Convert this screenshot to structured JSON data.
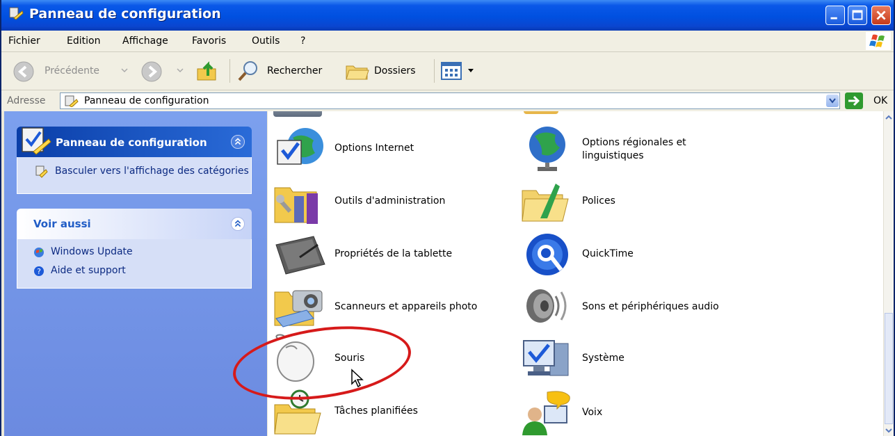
{
  "window": {
    "title": "Panneau de configuration"
  },
  "menu": [
    "Fichier",
    "Edition",
    "Affichage",
    "Favoris",
    "Outils",
    "?"
  ],
  "toolbar": {
    "back_label": "Précédente",
    "search_label": "Rechercher",
    "folders_label": "Dossiers"
  },
  "address": {
    "label": "Adresse",
    "value": "Panneau de configuration",
    "go_label": "OK"
  },
  "left_pane": {
    "control_panel": {
      "title": "Panneau de configuration",
      "task": "Basculer vers l'affichage des catégories"
    },
    "see_also": {
      "title": "Voir aussi",
      "links": [
        "Windows Update",
        "Aide et support"
      ]
    }
  },
  "items": [
    {
      "label": "Options Internet",
      "icon": "internet-options-icon"
    },
    {
      "label": "Options régionales et linguistiques",
      "icon": "regional-options-icon"
    },
    {
      "label": "Outils d'administration",
      "icon": "admin-tools-icon"
    },
    {
      "label": "Polices",
      "icon": "fonts-folder-icon"
    },
    {
      "label": "Propriétés de la tablette",
      "icon": "tablet-icon"
    },
    {
      "label": "QuickTime",
      "icon": "quicktime-icon"
    },
    {
      "label": "Scanneurs et appareils photo",
      "icon": "scanner-camera-icon"
    },
    {
      "label": "Sons et périphériques audio",
      "icon": "speaker-icon"
    },
    {
      "label": "Souris",
      "icon": "mouse-icon"
    },
    {
      "label": "Système",
      "icon": "system-icon"
    },
    {
      "label": "Tâches planifiées",
      "icon": "scheduled-tasks-icon"
    },
    {
      "label": "Voix",
      "icon": "speech-icon"
    }
  ],
  "colors": {
    "titlebar": "#0050e0",
    "left_pane": "#7ca0ee",
    "highlight_circle": "#d61a1a"
  }
}
